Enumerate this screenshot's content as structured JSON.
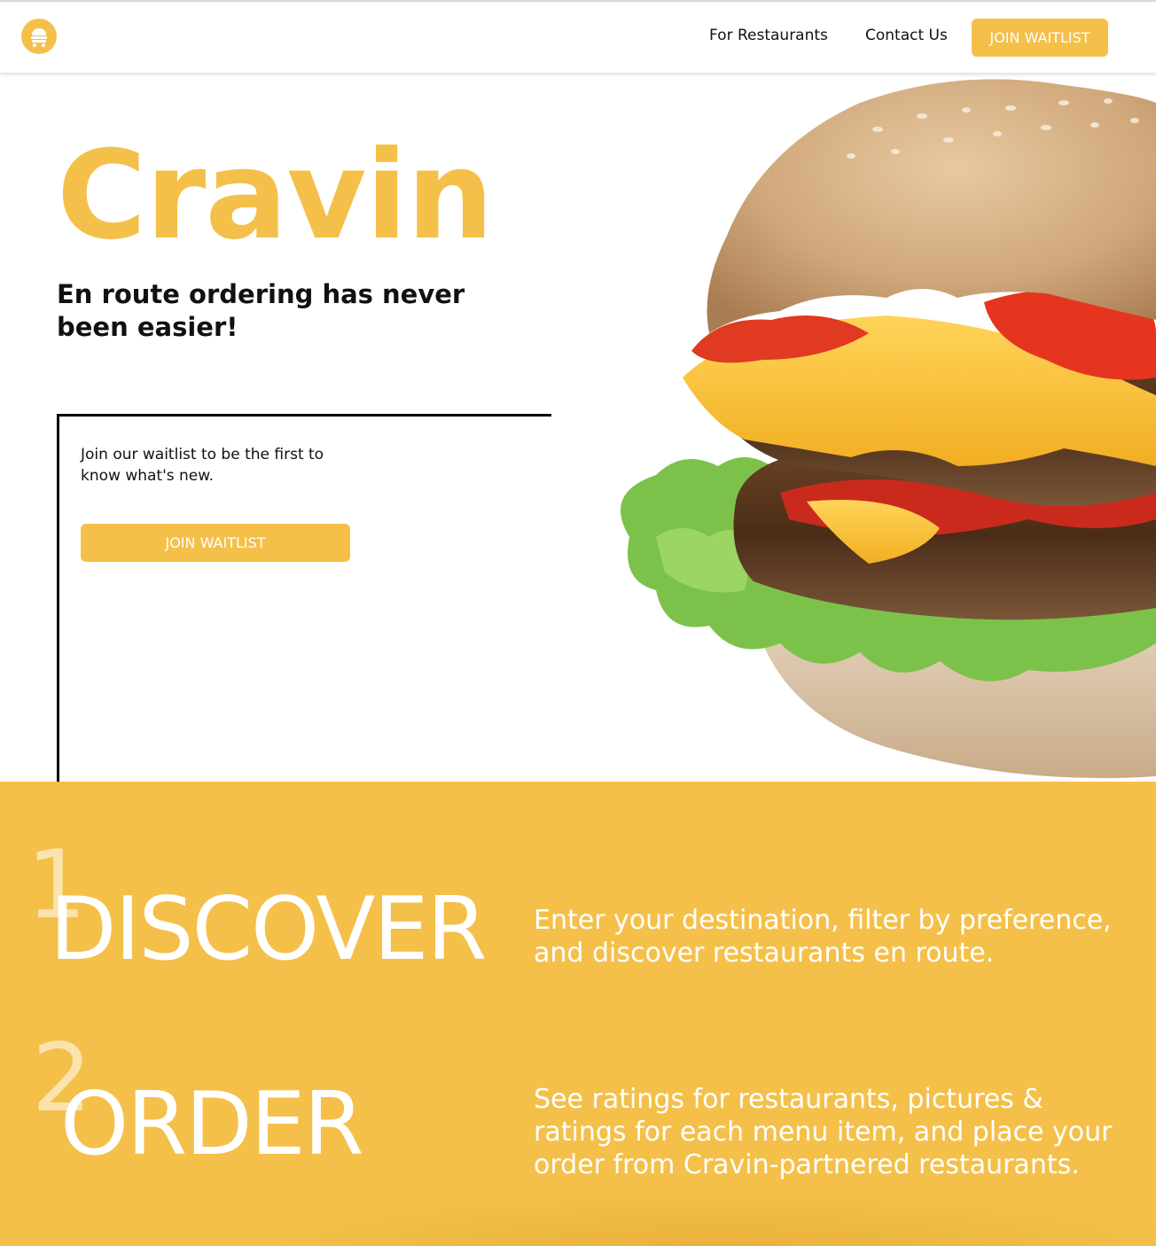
{
  "nav": {
    "logo_icon": "food-cart-icon",
    "links": [
      "For Restaurants",
      "Contact Us"
    ],
    "cta_label": "JOIN WAITLIST"
  },
  "hero": {
    "title": "Cravin",
    "tagline": "En route ordering has never been easier!",
    "image": "burger-photo"
  },
  "waitlist": {
    "text": "Join our waitlist to be the first to know what's new.",
    "button_label": "JOIN WAITLIST"
  },
  "steps": [
    {
      "number": "1",
      "title": "DISCOVER",
      "description": "Enter your destination, filter by preference, and discover restaurants en route."
    },
    {
      "number": "2",
      "title": "ORDER",
      "description": "See ratings for restaurants, pictures & ratings for each menu item, and place your order from Cravin-partnered restaurants."
    }
  ],
  "colors": {
    "accent": "#f4c04a",
    "text": "#111111",
    "background": "#ffffff"
  }
}
